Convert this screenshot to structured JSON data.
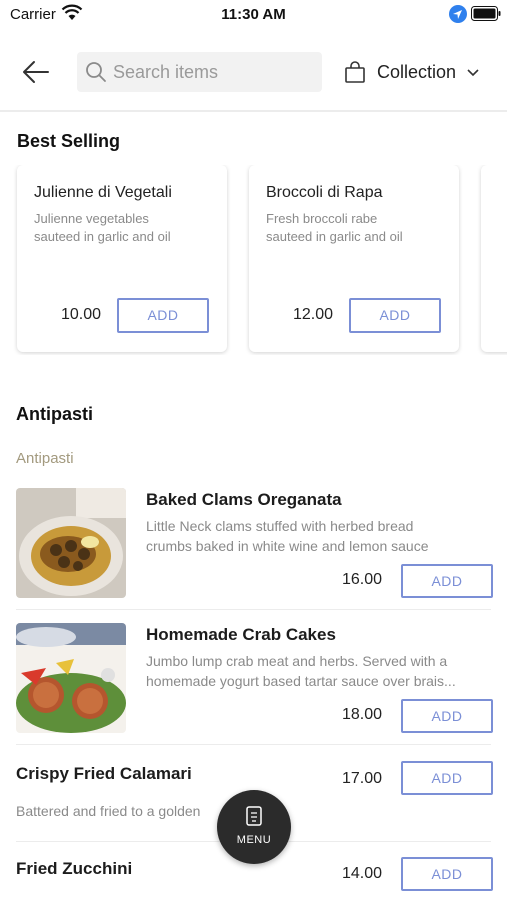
{
  "status_bar": {
    "carrier": "Carrier",
    "time": "11:30 AM"
  },
  "header": {
    "search_placeholder": "Search items",
    "collection_label": "Collection"
  },
  "best_selling": {
    "title": "Best Selling",
    "items": [
      {
        "name": "Julienne di Vegetali",
        "desc_line1": "Julienne vegetables",
        "desc_line2": "sauteed in garlic and oil",
        "price": "10.00",
        "add_label": "ADD"
      },
      {
        "name": "Broccoli di Rapa",
        "desc_line1": "Fresh broccoli rabe",
        "desc_line2": "sauteed in garlic and oil",
        "price": "12.00",
        "add_label": "ADD"
      }
    ]
  },
  "antipasti": {
    "title": "Antipasti",
    "subcategory": "Antipasti",
    "items": [
      {
        "name": "Baked Clams Oreganata",
        "desc_line1": "Little Neck clams stuffed with herbed bread",
        "desc_line2": "crumbs baked in white wine and lemon sauce",
        "price": "16.00",
        "add_label": "ADD"
      },
      {
        "name": "Homemade Crab Cakes",
        "desc_line1": "Jumbo lump crab meat and herbs. Served with a",
        "desc_line2": "homemade yogurt based tartar sauce over brais...",
        "price": "18.00",
        "add_label": "ADD"
      },
      {
        "name": "Crispy Fried Calamari",
        "desc_line1": "Battered and fried to a golden",
        "price": "17.00",
        "add_label": "ADD"
      },
      {
        "name": "Fried Zucchini",
        "price": "14.00",
        "add_label": "ADD"
      }
    ]
  },
  "menu_fab": {
    "label": "MENU"
  },
  "colors": {
    "accent": "#7b8fd6",
    "subcategory": "#a39a7f",
    "fab": "#2b2b2b"
  }
}
